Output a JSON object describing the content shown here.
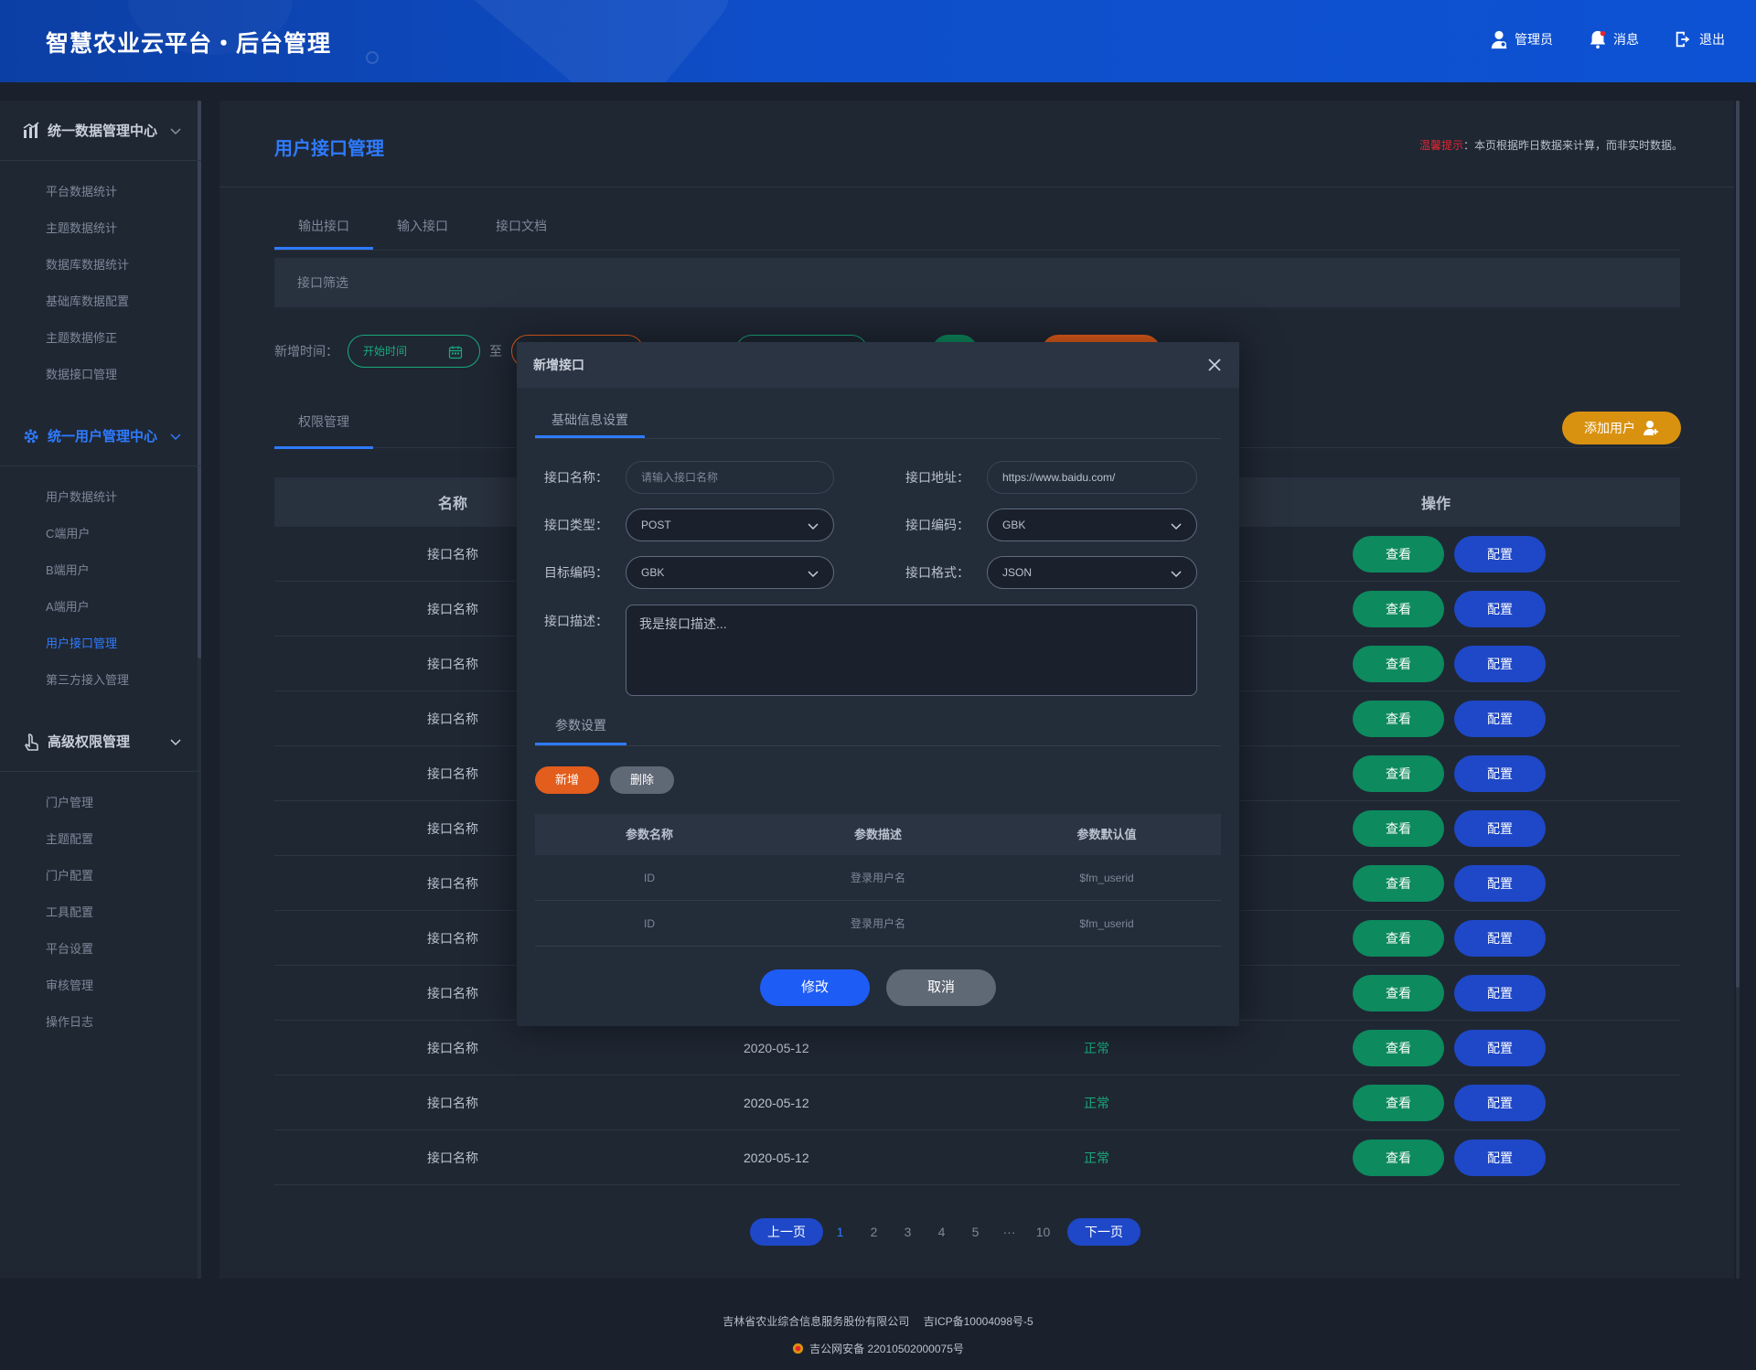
{
  "header": {
    "title": "智慧农业云平台・后台管理",
    "admin_label": "管理员",
    "message_label": "消息",
    "logout_label": "退出"
  },
  "sidebar": {
    "groups": [
      {
        "title": "统一数据管理中心",
        "icon": "bar-chart-icon",
        "items": [
          "平台数据统计",
          "主题数据统计",
          "数据库数据统计",
          "基础库数据配置",
          "主题数据修正",
          "数据接口管理"
        ]
      },
      {
        "title": "统一用户管理中心",
        "icon": "gear-icon",
        "items": [
          "用户数据统计",
          "C端用户",
          "B端用户",
          "A端用户",
          "用户接口管理",
          "第三方接入管理"
        ]
      },
      {
        "title": "高级权限管理",
        "icon": "touch-icon",
        "items": [
          "门户管理",
          "主题配置",
          "门户配置",
          "工具配置",
          "平台设置",
          "审核管理",
          "操作日志"
        ]
      }
    ]
  },
  "main": {
    "page_title": "用户接口管理",
    "tip_prefix": "温馨提示",
    "tip_text": "：本页根据昨日数据来计算，而非实时数据。",
    "tabs": [
      "输出接口",
      "输入接口",
      "接口文档"
    ],
    "filter_bar_label": "接口筛选",
    "filter_date_label": "新增时间：",
    "filter_start_placeholder": "开始时间",
    "filter_to": "至",
    "sub_tab": "权限管理",
    "add_user_label": "添加用户",
    "table_headers": {
      "name": "名称",
      "action": "操作"
    },
    "rows": [
      {
        "name": "接口名称",
        "date": "",
        "status": ""
      },
      {
        "name": "接口名称",
        "date": "",
        "status": ""
      },
      {
        "name": "接口名称",
        "date": "",
        "status": ""
      },
      {
        "name": "接口名称",
        "date": "",
        "status": ""
      },
      {
        "name": "接口名称",
        "date": "",
        "status": ""
      },
      {
        "name": "接口名称",
        "date": "",
        "status": ""
      },
      {
        "name": "接口名称",
        "date": "",
        "status": ""
      },
      {
        "name": "接口名称",
        "date": "",
        "status": ""
      },
      {
        "name": "接口名称",
        "date": "",
        "status": ""
      },
      {
        "name": "接口名称",
        "date": "2020-05-12",
        "status": "正常"
      },
      {
        "name": "接口名称",
        "date": "2020-05-12",
        "status": "正常"
      },
      {
        "name": "接口名称",
        "date": "2020-05-12",
        "status": "正常"
      }
    ],
    "view_label": "查看",
    "config_label": "配置",
    "pager": {
      "prev": "上一页",
      "next": "下一页",
      "pages": [
        "1",
        "2",
        "3",
        "4",
        "5",
        "···",
        "10"
      ],
      "current": "1"
    }
  },
  "modal": {
    "title": "新增接口",
    "tab_basic": "基础信息设置",
    "fields": {
      "name_label": "接口名称：",
      "name_placeholder": "请输入接口名称",
      "url_label": "接口地址：",
      "url_value": "https://www.baidu.com/",
      "type_label": "接口类型：",
      "type_value": "POST",
      "encoding_label": "接口编码：",
      "encoding_value": "GBK",
      "target_label": "目标编码：",
      "target_value": "GBK",
      "format_label": "接口格式：",
      "format_value": "JSON",
      "desc_label": "接口描述：",
      "desc_value": "我是接口描述..."
    },
    "tab_params": "参数设置",
    "add_label": "新增",
    "delete_label": "删除",
    "param_headers": [
      "参数名称",
      "参数描述",
      "参数默认值"
    ],
    "param_rows": [
      [
        "ID",
        "登录用户名",
        "$fm_userid"
      ],
      [
        "ID",
        "登录用户名",
        "$fm_userid"
      ]
    ],
    "save_label": "修改",
    "cancel_label": "取消"
  },
  "footer": {
    "line1": "吉林省农业综合信息服务股份有限公司　 吉ICP备10004098号-5",
    "line2": "吉公网安备 22010502000075号"
  },
  "colors": {
    "accent": "#2e7bff",
    "view_button": "#0d8a5e",
    "config_button": "#1e48c8",
    "add_user_button": "#d99210",
    "add_param_button": "#e35d1c",
    "status_ok": "#19a97b"
  }
}
